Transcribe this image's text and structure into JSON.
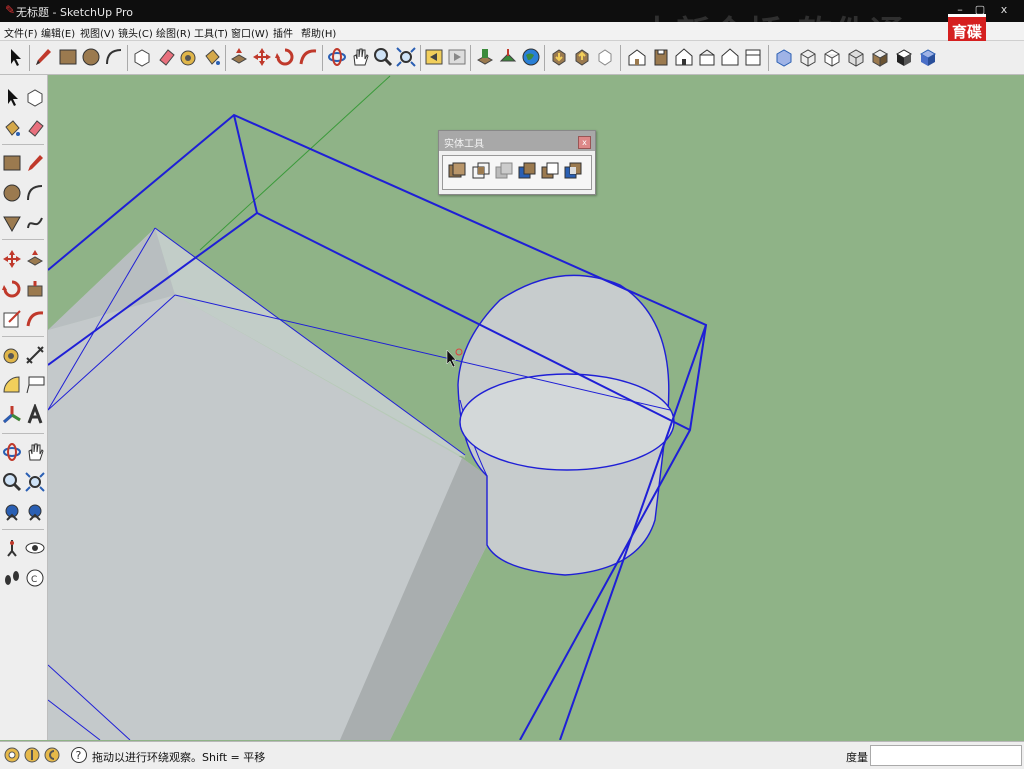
{
  "window": {
    "title": "无标题 - SketchUp Pro",
    "watermark": "中新金桥 软件通",
    "logo_text": "育碟软件",
    "minimize_glyph": "–",
    "maximize_glyph": "▢",
    "close_glyph": "x"
  },
  "menu": [
    {
      "label": "文件(F)"
    },
    {
      "label": "编辑(E)"
    },
    {
      "label": "视图(V)"
    },
    {
      "label": "镜头(C)"
    },
    {
      "label": "绘图(R)"
    },
    {
      "label": "工具(T)"
    },
    {
      "label": "窗口(W)"
    },
    {
      "label": "插件"
    },
    {
      "label": "帮助(H)"
    }
  ],
  "solid_tools_panel": {
    "title": "实体工具",
    "close_glyph": "x",
    "tools": [
      "outer-shell-icon",
      "intersect-icon",
      "union-icon",
      "subtract-icon",
      "trim-icon",
      "split-icon"
    ]
  },
  "status": {
    "hint": "拖动以进行环绕观察。Shift = 平移",
    "measure_label": "度量",
    "measure_value": "",
    "help_glyph": "?"
  },
  "colors": {
    "viewport_bg": "#8fb387",
    "selection_edge": "#1f1fd6",
    "face": "#c3c8c9",
    "title_bg": "#0e0e0e"
  }
}
